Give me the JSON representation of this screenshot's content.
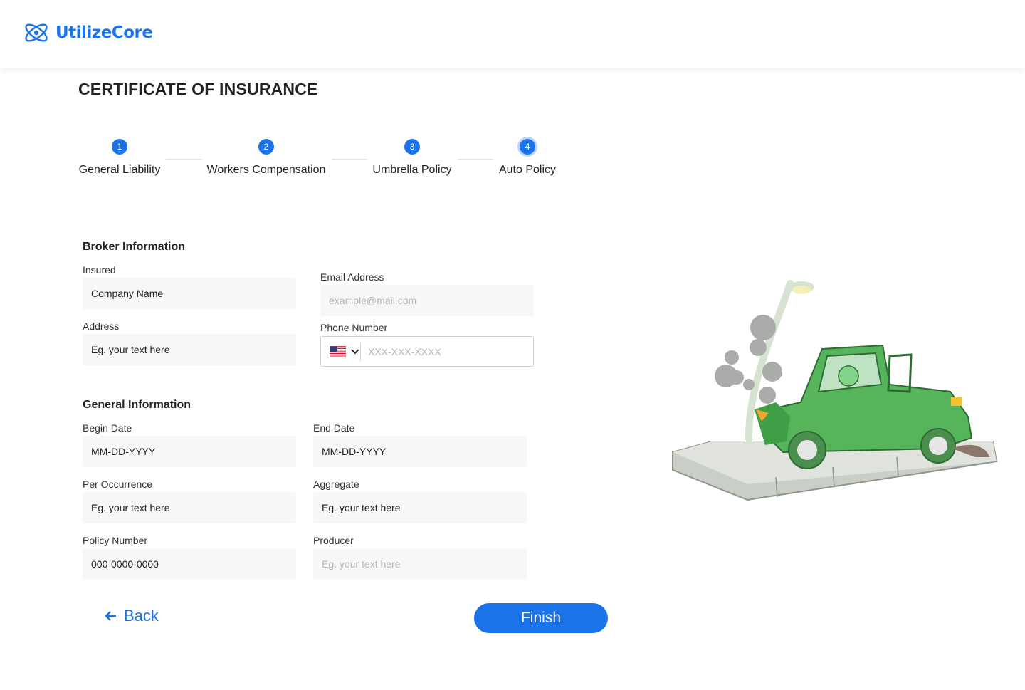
{
  "header": {
    "logo_text": "UtilizeCore"
  },
  "page_title": "CERTIFICATE OF INSURANCE",
  "steps": [
    {
      "number": "1",
      "label": "General Liability"
    },
    {
      "number": "2",
      "label": "Workers Compensation"
    },
    {
      "number": "3",
      "label": "Umbrella Policy"
    },
    {
      "number": "4",
      "label": "Auto Policy"
    }
  ],
  "broker": {
    "title": "Broker Information",
    "insured_label": "Insured",
    "insured_value": "Company Name",
    "address_label": "Address",
    "address_value": "Eg. your text here",
    "email_label": "Email Address",
    "email_placeholder": "example@mail.com",
    "phone_label": "Phone Number",
    "phone_placeholder": "XXX-XXX-XXXX"
  },
  "general": {
    "title": "General Information",
    "begin_label": "Begin Date",
    "begin_value": "MM-DD-YYYY",
    "end_label": "End Date",
    "end_value": "MM-DD-YYYY",
    "occurrence_label": "Per Occurrence",
    "occurrence_value": "Eg. your text here",
    "aggregate_label": "Aggregate",
    "aggregate_value": "Eg. your text here",
    "policy_label": "Policy Number",
    "policy_value": "000-0000-0000",
    "producer_label": "Producer",
    "producer_placeholder": "Eg. your text here"
  },
  "actions": {
    "back_label": "Back",
    "finish_label": "Finish"
  },
  "colors": {
    "accent": "#1a73e8",
    "field_bg": "#f7f7f7",
    "car_green": "#4caf50"
  }
}
